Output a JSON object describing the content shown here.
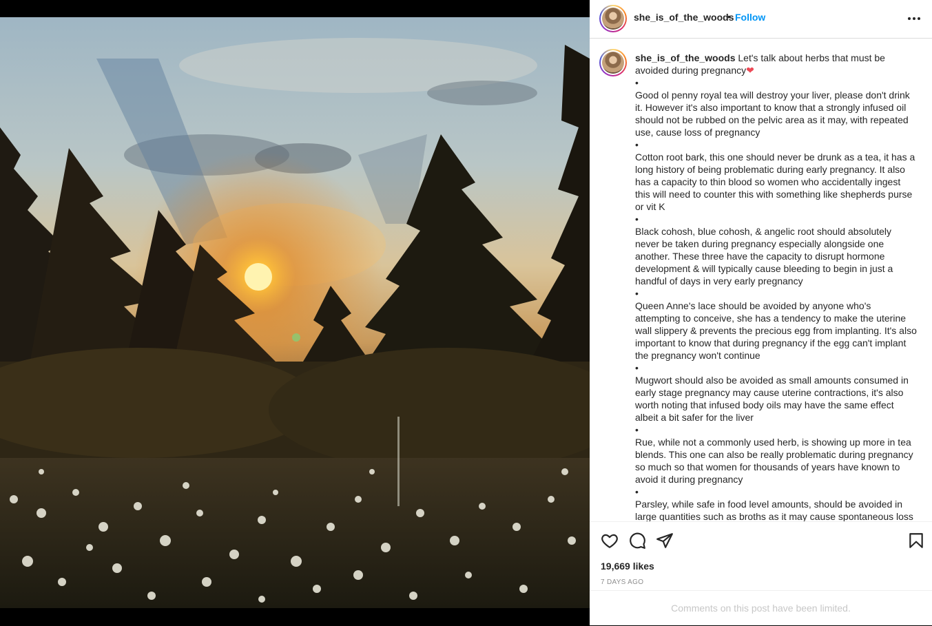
{
  "post": {
    "username": "she_is_of_the_woods",
    "separator": "•",
    "follow_label": "Follow",
    "likes": "19,669 likes",
    "date": "7 DAYS AGO",
    "comments_notice": "Comments on this post have been limited."
  },
  "icons": {
    "more": "more-options-icon",
    "like": "heart-icon",
    "comment": "comment-icon",
    "share": "share-icon",
    "save": "bookmark-icon"
  },
  "caption": {
    "intro": "Let's talk about herbs that must be avoided during pregnancy",
    "heart": "❤",
    "bullet": "•",
    "paragraphs": [
      "Good ol penny royal tea will destroy your liver, please don't drink it. However it's also important to know that a strongly infused oil should not be rubbed on the pelvic area as it may, with repeated use, cause loss of pregnancy",
      "Cotton root bark, this one should never be drunk as a tea, it has a long history of being problematic during early pregnancy. It also has a capacity to thin blood so women who accidentally ingest this will need to counter this with something like shepherds purse or vit K",
      "Black cohosh, blue cohosh, & angelic root should absolutely never be taken during pregnancy especially alongside one another. These three have the capacity to disrupt hormone development & will typically cause bleeding to begin in just a handful of days in very early pregnancy",
      "Queen Anne's lace should be avoided by anyone who's attempting to conceive, she has a tendency to make the uterine wall slippery & prevents the precious egg from implanting. It's also important to know that during pregnancy if the egg can't implant the pregnancy won't continue",
      "Mugwort should also be avoided as small amounts consumed in early stage pregnancy may cause uterine contractions, it's also worth noting that infused body oils may have the same effect albeit a bit safer for the liver",
      "Rue, while not a commonly used herb, is showing up more in tea blends. This one can also be really problematic during pregnancy so much so that women for thousands of years have known to avoid it during pregnancy",
      "Parsley, while safe in food level amounts, should be avoided in large quantities such as broths as it may cause spontaneous loss"
    ]
  },
  "colors": {
    "follow": "#0095f6",
    "text": "#262626",
    "muted": "#8e8e8e",
    "notice": "#c7c7c7"
  }
}
